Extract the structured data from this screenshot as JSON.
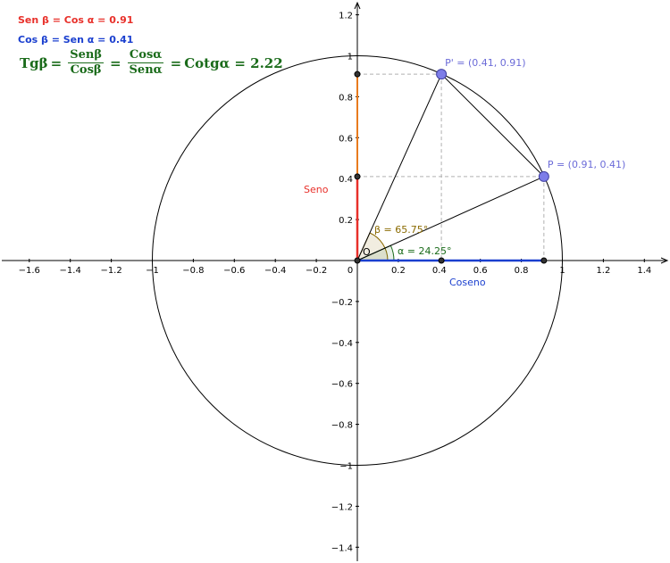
{
  "colors": {
    "sin": "#e8302a",
    "cos": "#1a3fcf",
    "formula": "#1a6b1a",
    "beta_angle": "#8a6a00",
    "alpha_angle": "#1a6b1a",
    "point": "#7d7de8",
    "point_label": "#6b6bd8",
    "orange_segment": "#e87b1e"
  },
  "info": {
    "line1": "Sen β = Cos α = 0.91",
    "line2": "Cos β = Sen α = 0.41"
  },
  "formula": {
    "lhs": "Tgβ",
    "eq": "=",
    "f1_num": "Senβ",
    "f1_den": "Cosβ",
    "f2_num": "Cosα",
    "f2_den": "Senα",
    "rhs": "Cotgα = 2.22"
  },
  "labels": {
    "origin": "O",
    "point_p": "P = (0.91, 0.41)",
    "point_p_prime": "P' = (0.41, 0.91)",
    "beta": "β = 65.75°",
    "alpha": "α = 24.25°",
    "seno": "Seno",
    "coseno": "Coseno"
  },
  "geometry": {
    "P": [
      0.91,
      0.41
    ],
    "P_prime": [
      0.41,
      0.91
    ],
    "alpha_deg": 24.25,
    "beta_deg": 65.75,
    "radius": 1
  },
  "axes": {
    "x_ticks": [
      "-1.6",
      "-1.4",
      "-1.2",
      "-1",
      "-0.8",
      "-0.6",
      "-0.4",
      "-0.2",
      "0",
      "0.2",
      "0.4",
      "0.6",
      "0.8",
      "1",
      "1.2",
      "1.4"
    ],
    "y_ticks": [
      "1.2",
      "1",
      "0.8",
      "0.6",
      "0.4",
      "0.2",
      "-0.2",
      "-0.4",
      "-0.6",
      "-0.8",
      "-1",
      "-1.2",
      "-1.4"
    ]
  }
}
